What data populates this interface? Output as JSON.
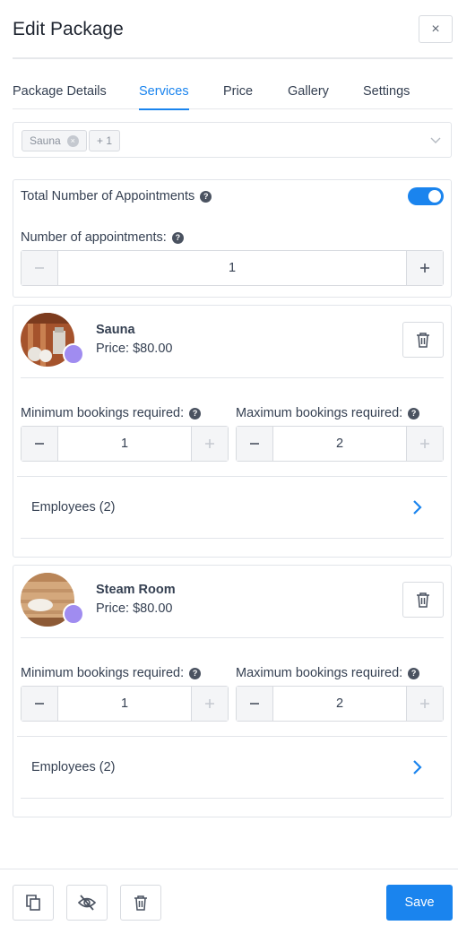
{
  "dialog": {
    "title": "Edit Package",
    "close_glyph": "×"
  },
  "tabs": [
    {
      "label": "Package Details",
      "active": false
    },
    {
      "label": "Services",
      "active": true
    },
    {
      "label": "Price",
      "active": false
    },
    {
      "label": "Gallery",
      "active": false
    },
    {
      "label": "Settings",
      "active": false
    }
  ],
  "service_select": {
    "chips": [
      {
        "label": "Sauna",
        "remove_glyph": "×"
      },
      {
        "label": "+ 1"
      }
    ],
    "icon": "chevron-down-icon"
  },
  "appointments": {
    "total_label": "Total Number of Appointments",
    "total_enabled": true,
    "count_label": "Number of appointments:",
    "count_value": "1",
    "help_glyph": "?"
  },
  "services": [
    {
      "name": "Sauna",
      "price": "Price: $80.00",
      "min_label": "Minimum bookings required:",
      "min_value": "1",
      "max_label": "Maximum bookings required:",
      "max_value": "2",
      "employees_label": "Employees (2)",
      "dot_color": "#a08cf0"
    },
    {
      "name": "Steam Room",
      "price": "Price: $80.00",
      "min_label": "Minimum bookings required:",
      "min_value": "1",
      "max_label": "Maximum bookings required:",
      "max_value": "2",
      "employees_label": "Employees (2)",
      "dot_color": "#a08cf0"
    }
  ],
  "footer": {
    "duplicate_icon": "copy-icon",
    "hide_icon": "eye-off-icon",
    "delete_icon": "trash-icon",
    "save_label": "Save"
  },
  "colors": {
    "accent": "#1a84ee",
    "text": "#354052",
    "border": "#e2e5ea"
  }
}
